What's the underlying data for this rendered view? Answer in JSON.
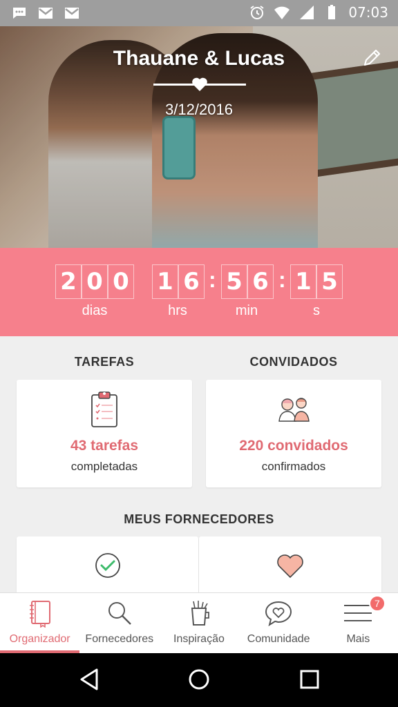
{
  "status_bar": {
    "time": "07:03",
    "left_icons": [
      "chat-notification-icon",
      "gmail-icon",
      "gmail-icon"
    ],
    "right_icons": [
      "alarm-icon",
      "wifi-icon",
      "signal-icon",
      "battery-icon"
    ]
  },
  "hero": {
    "names": "Thauane & Lucas",
    "date": "3/12/2016"
  },
  "countdown": {
    "days": [
      "2",
      "0",
      "0"
    ],
    "hours": [
      "1",
      "6"
    ],
    "minutes": [
      "5",
      "6"
    ],
    "seconds": [
      "1",
      "5"
    ],
    "labels": {
      "days": "dias",
      "hours": "hrs",
      "minutes": "min",
      "seconds": "s"
    }
  },
  "tasks": {
    "title": "TAREFAS",
    "count": "43 tarefas",
    "sub": "completadas"
  },
  "guests": {
    "title": "CONVIDADOS",
    "count": "220 convidados",
    "sub": "confirmados"
  },
  "vendors": {
    "title": "MEUS FORNECEDORES"
  },
  "bottom_nav": {
    "items": [
      {
        "label": "Organizador",
        "icon": "notebook-icon"
      },
      {
        "label": "Fornecedores",
        "icon": "search-icon"
      },
      {
        "label": "Inspiração",
        "icon": "cup-icon"
      },
      {
        "label": "Comunidade",
        "icon": "chat-heart-icon"
      },
      {
        "label": "Mais",
        "icon": "menu-icon",
        "badge": "7"
      }
    ]
  },
  "colors": {
    "accent": "#f6808c",
    "accent_text": "#e06a72",
    "background": "#efefef"
  }
}
